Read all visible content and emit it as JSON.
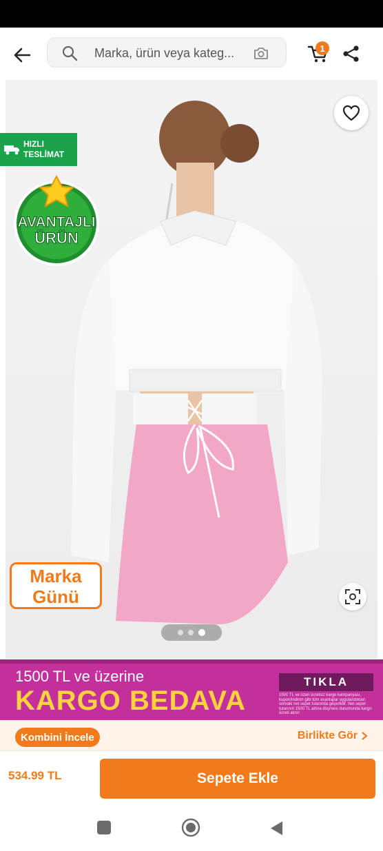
{
  "header": {
    "search_placeholder": "Marka, ürün veya kateg...",
    "cart_count": "1"
  },
  "product": {
    "fast_delivery": [
      "HIZLI",
      "TESLİMAT"
    ],
    "advantage_badge": [
      "AVANTAJLI",
      "ÜRÜN"
    ],
    "brand_day": [
      "Marka",
      "Günü"
    ],
    "image_count": 3,
    "active_image_index": 2
  },
  "promo": {
    "line1": "1500 TL ve üzerine",
    "line2": "KARGO BEDAVA",
    "cta": "TIKLA",
    "fine_print": "1500 TL ve üzeri ücretsiz kargo kampanyası, kupon/indirim gibi tüm avantajlar uygulandıktan sonraki net sepet tutarında geçerlidir. Net sepet tutarının 1500 TL altına düşmesi durumunda kargo ücreti alınır."
  },
  "combine": {
    "button": "Kombini İncele",
    "link": "Birlikte Gör"
  },
  "footer": {
    "price": "534.99 TL",
    "add_to_cart": "Sepete Ekle"
  },
  "colors": {
    "accent": "#f27a1a",
    "promo_bg": "#c3309c",
    "fast_green": "#1aa34a"
  }
}
